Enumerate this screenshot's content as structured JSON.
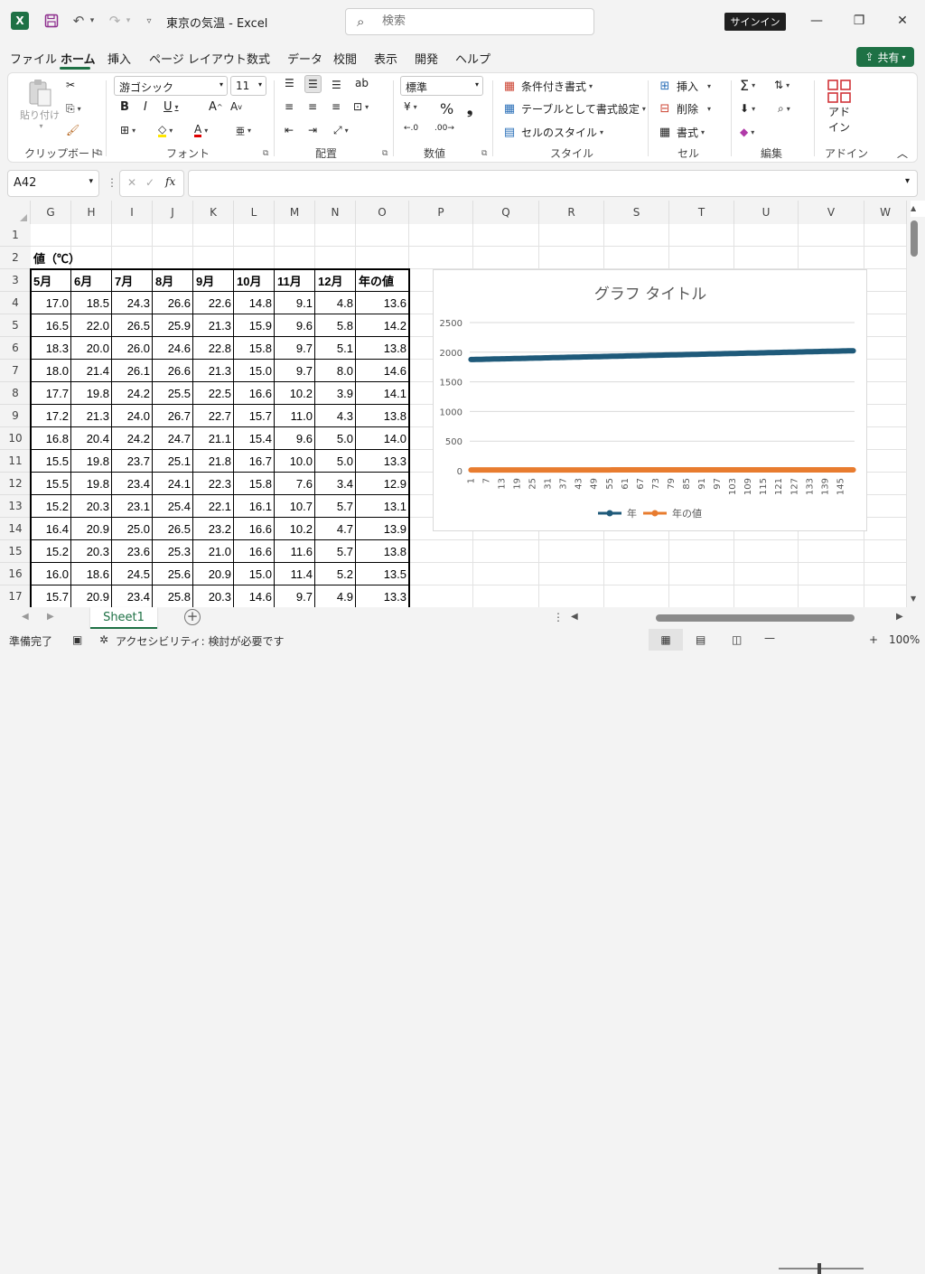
{
  "app": {
    "logo": "X",
    "title": "東京の気温  -  Excel",
    "search_placeholder": "検索",
    "signin": "サインイン",
    "share": "共有"
  },
  "menu": [
    "ファイル",
    "ホーム",
    "挿入",
    "ページ レイアウト",
    "数式",
    "データ",
    "校閲",
    "表示",
    "開発",
    "ヘルプ"
  ],
  "ribbon": {
    "clipboard": {
      "paste": "貼り付け",
      "label": "クリップボード"
    },
    "font": {
      "name": "游ゴシック",
      "size": "11",
      "label": "フォント",
      "bold": "B",
      "italic": "I",
      "underline": "U",
      "grow": "A",
      "shrink": "A"
    },
    "alignment": {
      "label": "配置"
    },
    "number": {
      "format": "標準",
      "label": "数値",
      "percent": "%"
    },
    "styles": {
      "conditional": "条件付き書式",
      "table": "テーブルとして書式設定",
      "cell_styles": "セルのスタイル",
      "label": "スタイル"
    },
    "cells": {
      "insert": "挿入",
      "delete": "削除",
      "format": "書式",
      "label": "セル"
    },
    "editing": {
      "label": "編集"
    },
    "addins": {
      "name_line1": "アド",
      "name_line2": "イン",
      "label": "アドイン"
    }
  },
  "formula_bar": {
    "name_box": "A42",
    "fx": "fx",
    "formula": ""
  },
  "columns": [
    "G",
    "H",
    "I",
    "J",
    "K",
    "L",
    "M",
    "N",
    "O",
    "P",
    "Q",
    "R",
    "S",
    "T",
    "U",
    "V",
    "W"
  ],
  "rows": [
    "1",
    "2",
    "3",
    "4",
    "5",
    "6",
    "7",
    "8",
    "9",
    "10",
    "11",
    "12",
    "13",
    "14",
    "15",
    "16",
    "17"
  ],
  "sheet": {
    "row2_text": "値（℃）",
    "headers": [
      "5月",
      "6月",
      "7月",
      "8月",
      "9月",
      "10月",
      "11月",
      "12月",
      "年の値"
    ],
    "data": [
      [
        "17.0",
        "18.5",
        "24.3",
        "26.6",
        "22.6",
        "14.8",
        "9.1",
        "4.8",
        "13.6"
      ],
      [
        "16.5",
        "22.0",
        "26.5",
        "25.9",
        "21.3",
        "15.9",
        "9.6",
        "5.8",
        "14.2"
      ],
      [
        "18.3",
        "20.0",
        "26.0",
        "24.6",
        "22.8",
        "15.8",
        "9.7",
        "5.1",
        "13.8"
      ],
      [
        "18.0",
        "21.4",
        "26.1",
        "26.6",
        "21.3",
        "15.0",
        "9.7",
        "8.0",
        "14.6"
      ],
      [
        "17.7",
        "19.8",
        "24.2",
        "25.5",
        "22.5",
        "16.6",
        "10.2",
        "3.9",
        "14.1"
      ],
      [
        "17.2",
        "21.3",
        "24.0",
        "26.7",
        "22.7",
        "15.7",
        "11.0",
        "4.3",
        "13.8"
      ],
      [
        "16.8",
        "20.4",
        "24.2",
        "24.7",
        "21.1",
        "15.4",
        "9.6",
        "5.0",
        "14.0"
      ],
      [
        "15.5",
        "19.8",
        "23.7",
        "25.1",
        "21.8",
        "16.7",
        "10.0",
        "5.0",
        "13.3"
      ],
      [
        "15.5",
        "19.8",
        "23.4",
        "24.1",
        "22.3",
        "15.8",
        "7.6",
        "3.4",
        "12.9"
      ],
      [
        "15.2",
        "20.3",
        "23.1",
        "25.4",
        "22.1",
        "16.1",
        "10.7",
        "5.7",
        "13.1"
      ],
      [
        "16.4",
        "20.9",
        "25.0",
        "26.5",
        "23.2",
        "16.6",
        "10.2",
        "4.7",
        "13.9"
      ],
      [
        "15.2",
        "20.3",
        "23.6",
        "25.3",
        "21.0",
        "16.6",
        "11.6",
        "5.7",
        "13.8"
      ],
      [
        "16.0",
        "18.6",
        "24.5",
        "25.6",
        "20.9",
        "15.0",
        "11.4",
        "5.2",
        "13.5"
      ],
      [
        "15.7",
        "20.9",
        "23.4",
        "25.8",
        "20.3",
        "14.6",
        "9.7",
        "4.9",
        "13.3"
      ]
    ]
  },
  "chart_data": {
    "type": "line",
    "title": "グラフ タイトル",
    "ylim": [
      0,
      2500
    ],
    "yticks": [
      0,
      500,
      1000,
      1500,
      2000,
      2500
    ],
    "x_start": 1,
    "x_count": 150,
    "xtick_labels": [
      "1",
      "7",
      "13",
      "19",
      "25",
      "31",
      "37",
      "43",
      "49",
      "55",
      "61",
      "67",
      "73",
      "79",
      "85",
      "91",
      "97",
      "103",
      "109",
      "115",
      "121",
      "127",
      "133",
      "139",
      "145"
    ],
    "series": [
      {
        "name": "年",
        "start": 1876,
        "end": 2025,
        "color": "#1f5a7a"
      },
      {
        "name": "年の値",
        "start": 13.6,
        "end": 16.0,
        "color": "#e87c2f"
      }
    ],
    "legend": "bottom",
    "grid": true
  },
  "sheet_tabs": {
    "active": "Sheet1",
    "add": "+"
  },
  "status": {
    "ready": "準備完了",
    "accessibility": "アクセシビリティ: 検討が必要です",
    "zoom": "100%"
  }
}
